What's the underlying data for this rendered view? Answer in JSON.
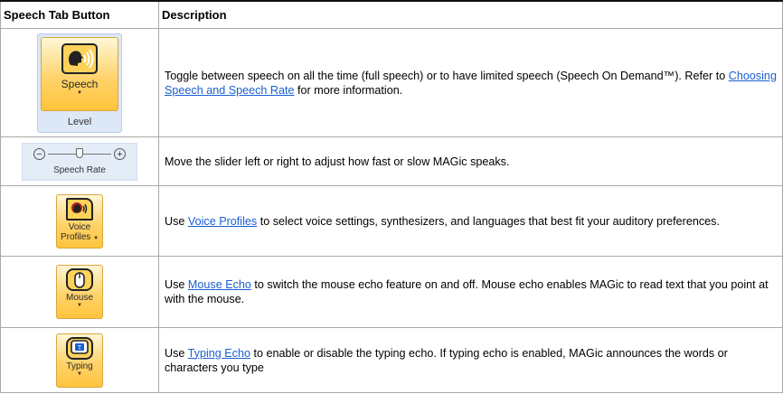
{
  "table": {
    "headers": [
      "Speech Tab Button",
      "Description"
    ],
    "rows": [
      {
        "button": {
          "label": "Speech",
          "sublabel": "Level"
        },
        "desc_before": "Toggle between speech on all the time (full speech) or to have limited speech (Speech On Demand™). Refer to ",
        "link": "Choosing Speech and Speech Rate",
        "desc_after": " for more information."
      },
      {
        "button": {
          "label": "Speech Rate",
          "minus": "−",
          "plus": "+"
        },
        "desc": "Move the slider left or right to adjust how fast or slow MAGic speaks."
      },
      {
        "button": {
          "label_line1": "Voice",
          "label_line2": "Profiles"
        },
        "desc_before": "Use ",
        "link": "Voice Profiles",
        "desc_after": " to select voice settings, synthesizers, and languages that best fit your auditory preferences."
      },
      {
        "button": {
          "label": "Mouse"
        },
        "desc_before": "Use ",
        "link": "Mouse Echo",
        "desc_after": " to switch the mouse echo feature on and off. Mouse echo enables MAGic to read text that you point at with the mouse."
      },
      {
        "button": {
          "label": "Typing"
        },
        "desc_before": "Use ",
        "link": "Typing Echo",
        "desc_after": " to enable or disable the typing echo. If typing echo is enabled, MAGic announces the words or characters you type"
      }
    ]
  },
  "icons": {
    "speech": "speech-head-icon",
    "voice": "voice-profiles-icon",
    "mouse": "mouse-icon",
    "typing": "typing-icon",
    "dropdown": "dropdown-arrow-icon"
  },
  "colors": {
    "link": "#1a5fd0",
    "button_fill": "#ffd36b",
    "border": "#a9a9a9"
  }
}
